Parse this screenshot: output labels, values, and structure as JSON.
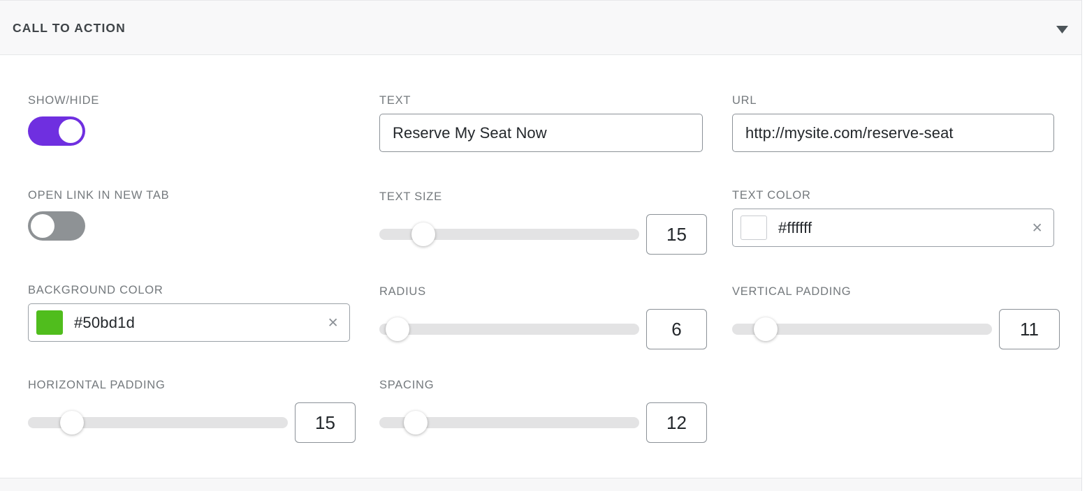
{
  "section": {
    "title": "CALL TO ACTION",
    "collapse_icon": "chevron-down-icon"
  },
  "colors": {
    "toggle_on": "#6f2fe0",
    "toggle_off": "#8e9295",
    "background_color_swatch": "#50bd1d",
    "text_color_swatch": "#ffffff",
    "slider_track": "#e3e3e4"
  },
  "fields": {
    "show_hide": {
      "label": "SHOW/HIDE",
      "state": "on"
    },
    "text": {
      "label": "TEXT",
      "value": "Reserve My Seat Now",
      "placeholder": "Reserve My Seat Now"
    },
    "url": {
      "label": "URL",
      "value": "http://mysite.com/reserve-seat",
      "placeholder": "http://mysite.com/reserve-seat"
    },
    "open_link_new_tab": {
      "label": "OPEN LINK IN NEW TAB",
      "state": "off"
    },
    "text_size": {
      "label": "TEXT SIZE",
      "value": "15",
      "percent": 17
    },
    "text_color": {
      "label": "TEXT COLOR",
      "value": "#ffffff",
      "clear_label": "×"
    },
    "background_color": {
      "label": "BACKGROUND COLOR",
      "value": "#50bd1d",
      "clear_label": "×"
    },
    "radius": {
      "label": "RADIUS",
      "value": "6",
      "percent": 7
    },
    "vertical_padding": {
      "label": "VERTICAL PADDING",
      "value": "11",
      "percent": 13
    },
    "horizontal_padding": {
      "label": "HORIZONTAL PADDING",
      "value": "15",
      "percent": 17
    },
    "spacing": {
      "label": "SPACING",
      "value": "12",
      "percent": 14
    }
  }
}
